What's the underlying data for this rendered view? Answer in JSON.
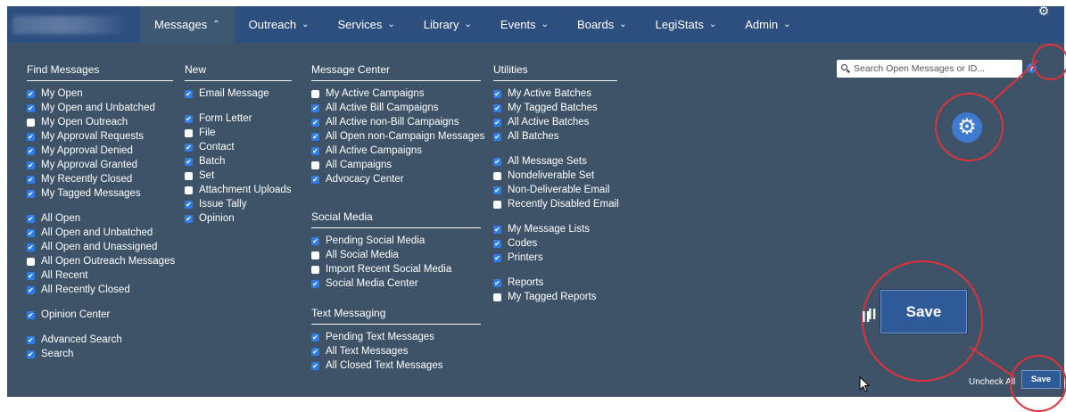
{
  "nav": {
    "items": [
      {
        "label": "Messages",
        "chevron": "^"
      },
      {
        "label": "Outreach",
        "chevron": "v"
      },
      {
        "label": "Services",
        "chevron": "v"
      },
      {
        "label": "Library",
        "chevron": "v"
      },
      {
        "label": "Events",
        "chevron": "v"
      },
      {
        "label": "Boards",
        "chevron": "v"
      },
      {
        "label": "LegiStats",
        "chevron": "v"
      },
      {
        "label": "Admin",
        "chevron": "v"
      }
    ]
  },
  "columns": {
    "find": {
      "title": "Find Messages",
      "items": [
        {
          "label": "My Open",
          "checked": true
        },
        {
          "label": "My Open and Unbatched",
          "checked": true
        },
        {
          "label": "My Open Outreach",
          "checked": false
        },
        {
          "label": "My Approval Requests",
          "checked": true
        },
        {
          "label": "My Approval Denied",
          "checked": true
        },
        {
          "label": "My Approval Granted",
          "checked": true
        },
        {
          "label": "My Recently Closed",
          "checked": true
        },
        {
          "label": "My Tagged Messages",
          "checked": true
        },
        {
          "gap": true
        },
        {
          "label": "All Open",
          "checked": true
        },
        {
          "label": "All Open and Unbatched",
          "checked": true
        },
        {
          "label": "All Open and Unassigned",
          "checked": true
        },
        {
          "label": "All Open Outreach Messages",
          "checked": false
        },
        {
          "label": "All Recent",
          "checked": true
        },
        {
          "label": "All Recently Closed",
          "checked": true
        },
        {
          "gap": true
        },
        {
          "label": "Opinion Center",
          "checked": true
        },
        {
          "gap": true
        },
        {
          "label": "Advanced Search",
          "checked": true
        },
        {
          "label": "Search",
          "checked": true
        }
      ]
    },
    "new": {
      "title": "New",
      "items": [
        {
          "label": "Email Message",
          "checked": true
        },
        {
          "gap": true
        },
        {
          "label": "Form Letter",
          "checked": true
        },
        {
          "label": "File",
          "checked": false
        },
        {
          "label": "Contact",
          "checked": true
        },
        {
          "label": "Batch",
          "checked": true
        },
        {
          "label": "Set",
          "checked": false
        },
        {
          "label": "Attachment Uploads",
          "checked": false
        },
        {
          "label": "Issue Tally",
          "checked": true
        },
        {
          "label": "Opinion",
          "checked": true
        }
      ]
    },
    "message_center": {
      "title": "Message Center",
      "items": [
        {
          "label": "My Active Campaigns",
          "checked": false
        },
        {
          "label": "All Active Bill Campaigns",
          "checked": true
        },
        {
          "label": "All Active non-Bill Campaigns",
          "checked": true
        },
        {
          "label": "All Open non-Campaign Messages",
          "checked": true
        },
        {
          "label": "All Active Campaigns",
          "checked": true
        },
        {
          "label": "All Campaigns",
          "checked": false
        },
        {
          "label": "Advocacy Center",
          "checked": true
        }
      ]
    },
    "social_media": {
      "title": "Social Media",
      "items": [
        {
          "label": "Pending Social Media",
          "checked": true
        },
        {
          "label": "All Social Media",
          "checked": false
        },
        {
          "label": "Import Recent Social Media",
          "checked": false
        },
        {
          "label": "Social Media Center",
          "checked": true
        }
      ]
    },
    "text_messaging": {
      "title": "Text Messaging",
      "items": [
        {
          "label": "Pending Text Messages",
          "checked": true
        },
        {
          "label": "All Text Messages",
          "checked": true
        },
        {
          "label": "All Closed Text Messages",
          "checked": true
        }
      ]
    },
    "utilities": {
      "title": "Utilities",
      "items": [
        {
          "label": "My Active Batches",
          "checked": true
        },
        {
          "label": "My Tagged Batches",
          "checked": true
        },
        {
          "label": "All Active Batches",
          "checked": true
        },
        {
          "label": "All Batches",
          "checked": true
        },
        {
          "gap": true
        },
        {
          "label": "All Message Sets",
          "checked": true
        },
        {
          "label": "Nondeliverable Set",
          "checked": false
        },
        {
          "label": "Non-Deliverable Email",
          "checked": true
        },
        {
          "label": "Recently Disabled Email",
          "checked": false
        },
        {
          "gap": true
        },
        {
          "label": "My Message Lists",
          "checked": true
        },
        {
          "label": "Codes",
          "checked": true
        },
        {
          "label": "Printers",
          "checked": true
        },
        {
          "gap": true
        },
        {
          "label": "Reports",
          "checked": true
        },
        {
          "label": "My Tagged Reports",
          "checked": false
        }
      ]
    }
  },
  "search": {
    "placeholder": "Search Open Messages or ID...",
    "help": "?"
  },
  "icons": {
    "settings": "gear-icon",
    "search": "search-icon",
    "help": "help-icon",
    "cursor": "cursor-arrow-icon"
  },
  "actions": {
    "save_label": "Save",
    "uncheck_label": "Uncheck All",
    "zoom_fragment": "ll"
  },
  "colors": {
    "nav_bg": "#2d4f80",
    "panel_bg": "#3e5367",
    "checkbox_on": "#2d7ee8",
    "highlight_circle": "#e0323a",
    "save_button": "#2f5a98"
  }
}
